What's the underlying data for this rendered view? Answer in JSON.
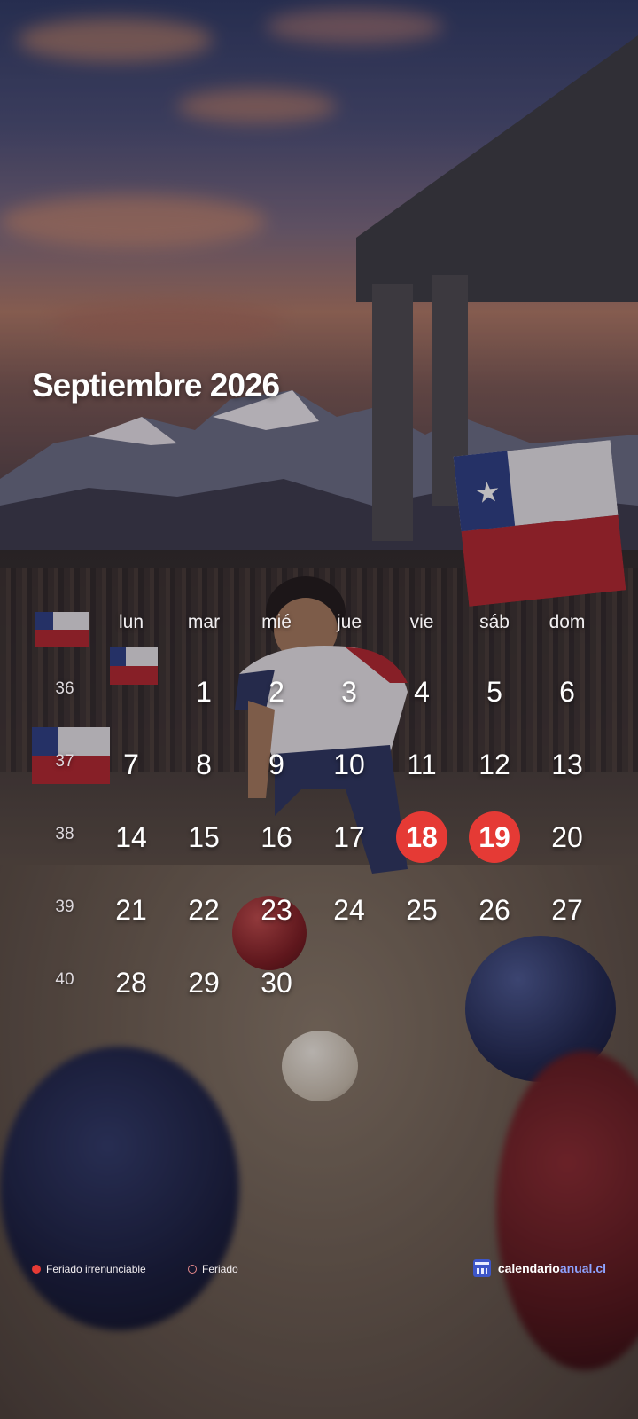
{
  "calendar": {
    "title": "Septiembre 2026",
    "weekdays": [
      "lun",
      "mar",
      "mié",
      "jue",
      "vie",
      "sáb",
      "dom"
    ],
    "weeks": [
      {
        "week": "36",
        "days": [
          "",
          "1",
          "2",
          "3",
          "4",
          "5",
          "6"
        ]
      },
      {
        "week": "37",
        "days": [
          "7",
          "8",
          "9",
          "10",
          "11",
          "12",
          "13"
        ]
      },
      {
        "week": "38",
        "days": [
          "14",
          "15",
          "16",
          "17",
          "18",
          "19",
          "20"
        ]
      },
      {
        "week": "39",
        "days": [
          "21",
          "22",
          "23",
          "24",
          "25",
          "26",
          "27"
        ]
      },
      {
        "week": "40",
        "days": [
          "28",
          "29",
          "30",
          "",
          "",
          "",
          ""
        ]
      }
    ],
    "irrenunciable_holidays": [
      "18",
      "19"
    ]
  },
  "legend": {
    "irrenunciable": "Feriado irrenunciable",
    "holiday": "Feriado"
  },
  "brand": {
    "name_part1": "calendario",
    "name_part2": "anual.cl"
  },
  "colors": {
    "holiday_irrenunciable": "#e53a35",
    "brand_accent": "#8ea3ff"
  }
}
